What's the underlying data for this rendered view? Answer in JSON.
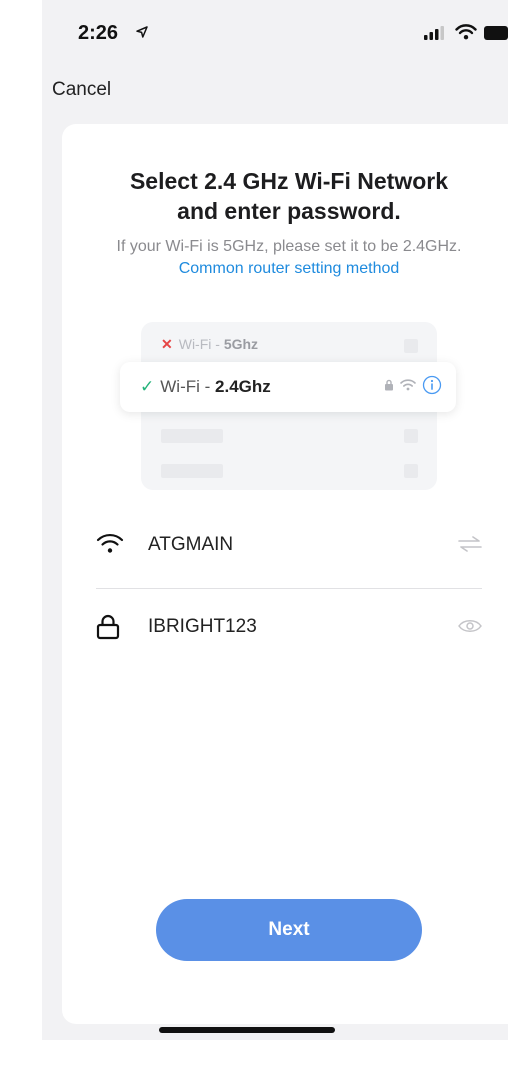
{
  "status_bar": {
    "time": "2:26"
  },
  "nav": {
    "cancel_label": "Cancel"
  },
  "header": {
    "title_line1": "Select 2.4 GHz Wi-Fi Network",
    "title_line2": "and enter password.",
    "subtitle": "If your Wi-Fi is 5GHz, please set it to be 2.4GHz.",
    "link_label": "Common router setting method"
  },
  "illustration": {
    "row_5g_prefix": "Wi-Fi - ",
    "row_5g_band": "5Ghz",
    "row_24g_prefix": "Wi-Fi - ",
    "row_24g_band": "2.4Ghz"
  },
  "form": {
    "ssid_value": "ATGMAIN",
    "password_value": "IBRIGHT123"
  },
  "actions": {
    "next_label": "Next"
  },
  "colors": {
    "accent_blue": "#5a90e6",
    "link_blue": "#1f8bde",
    "check_green": "#24b37a",
    "error_red": "#e64545"
  },
  "icons": [
    "location-arrow-icon",
    "signal-icon",
    "wifi-icon",
    "battery-icon",
    "x-icon",
    "check-icon",
    "lock-icon",
    "info-icon",
    "switch-arrows-icon",
    "eye-icon"
  ]
}
